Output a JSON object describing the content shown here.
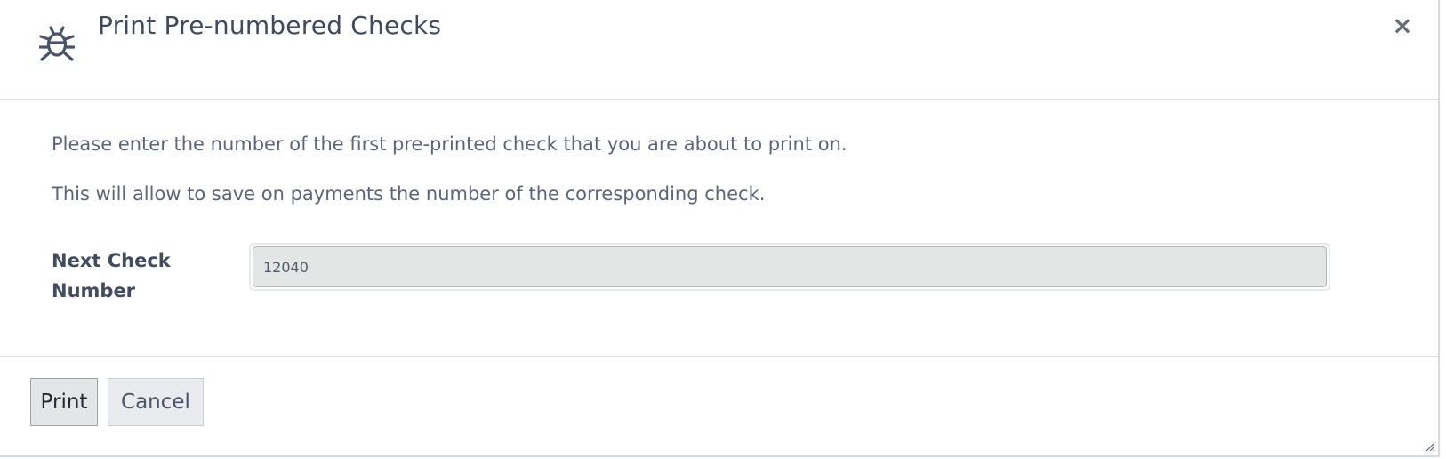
{
  "dialog": {
    "title": "Print Pre-numbered Checks",
    "close_symbol": "×",
    "icon": "bug-icon"
  },
  "body": {
    "paragraph_1": "Please enter the number of the first pre-printed check that you are about to print on.",
    "paragraph_2": "This will allow to save on payments the number of the corresponding check."
  },
  "form": {
    "next_check_label": "Next Check Number",
    "next_check_value": "12040"
  },
  "footer": {
    "print_label": "Print",
    "cancel_label": "Cancel"
  }
}
